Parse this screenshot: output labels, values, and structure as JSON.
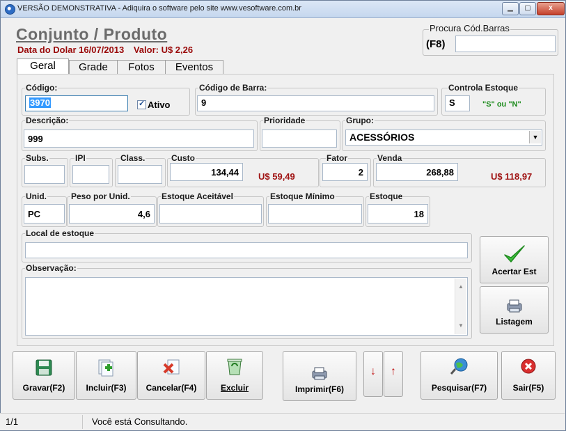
{
  "window": {
    "title": "VERSÃO DEMONSTRATIVA - Adiquira o software pelo site www.vesoftware.com.br",
    "min_label": "▁",
    "max_label": "▢",
    "close_label": "x"
  },
  "header": {
    "title": "Conjunto / Produto",
    "dolar_date": "Data do Dolar 16/07/2013",
    "dolar_value": "Valor: U$ 2,26"
  },
  "barcode_search": {
    "label": "Procura Cód.Barras",
    "key": "(F8)",
    "value": ""
  },
  "tabs": [
    "Geral",
    "Grade",
    "Fotos",
    "Eventos"
  ],
  "form": {
    "codigo": {
      "label": "Código:",
      "value": "3970"
    },
    "ativo": {
      "label": "Ativo",
      "checked": true
    },
    "codigo_barra": {
      "label": "Código de Barra:",
      "value": "9"
    },
    "controla_estoque": {
      "label": "Controla Estoque",
      "value": "S",
      "hint": "\"S\" ou \"N\""
    },
    "descricao": {
      "label": "Descrição:",
      "value": "999"
    },
    "prioridade": {
      "label": "Prioridade",
      "value": ""
    },
    "grupo": {
      "label": "Grupo:",
      "value": "ACESSÓRIOS"
    },
    "subs": {
      "label": "Subs.",
      "value": ""
    },
    "ipi": {
      "label": "IPI",
      "value": ""
    },
    "class": {
      "label": "Class.",
      "value": ""
    },
    "custo": {
      "label": "Custo",
      "value": "134,44",
      "usd": "U$ 59,49"
    },
    "fator": {
      "label": "Fator",
      "value": "2"
    },
    "venda": {
      "label": "Venda",
      "value": "268,88",
      "usd": "U$ 118,97"
    },
    "unid": {
      "label": "Unid.",
      "value": "PC"
    },
    "peso": {
      "label": "Peso por Unid.",
      "value": "4,6"
    },
    "estoque_aceitavel": {
      "label": "Estoque Aceitável",
      "value": ""
    },
    "estoque_minimo": {
      "label": "Estoque Mínimo",
      "value": ""
    },
    "estoque": {
      "label": "Estoque",
      "value": "18"
    },
    "local_estoque": {
      "label": "Local de estoque",
      "value": ""
    },
    "observacao": {
      "label": "Observação:",
      "value": ""
    }
  },
  "side_buttons": {
    "acertar": "Acertar Est",
    "listagem": "Listagem"
  },
  "toolbar": {
    "gravar": "Gravar(F2)",
    "incluir": "Incluir(F3)",
    "cancelar": "Cancelar(F4)",
    "excluir": "Excluir",
    "imprimir": "Imprimir(F6)",
    "down": "↓",
    "up": "↑",
    "pesquisar": "Pesquisar(F7)",
    "sair": "Sair(F5)"
  },
  "status": {
    "record": "1/1",
    "message": "Você está Consultando."
  },
  "colors": {
    "accent_red": "#a01414",
    "hint_green": "#1a8a1a",
    "selection": "#3399ff"
  }
}
